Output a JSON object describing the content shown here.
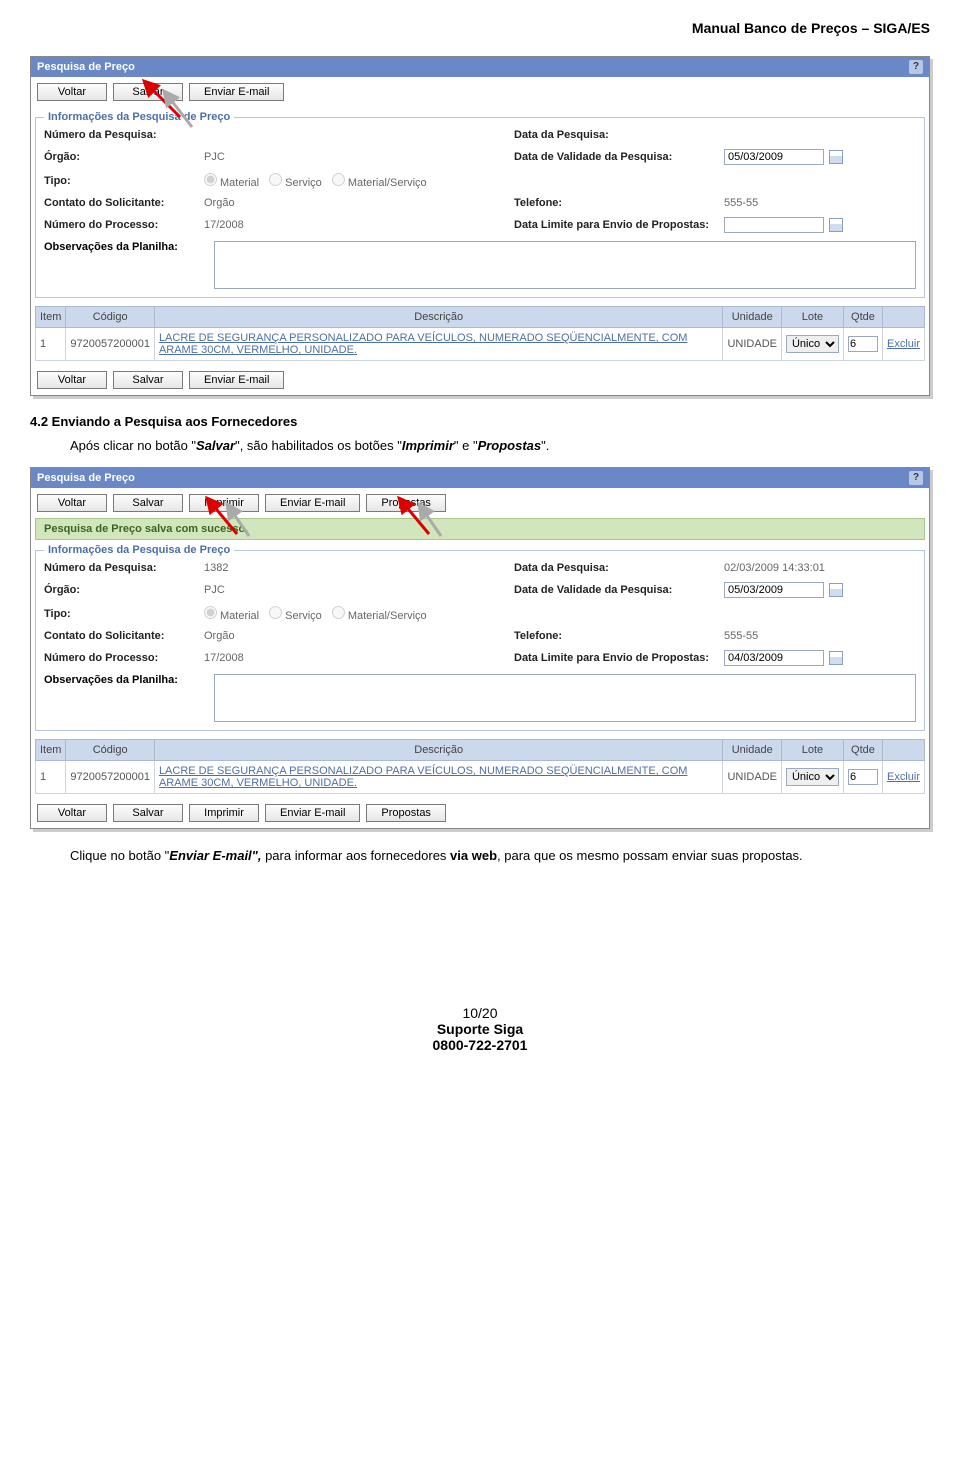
{
  "doc_header": "Manual Banco de Preços – SIGA/ES",
  "panel_title": "Pesquisa de Preço",
  "help_icon": "?",
  "buttons": {
    "voltar": "Voltar",
    "salvar": "Salvar",
    "imprimir": "Imprimir",
    "enviar_email": "Enviar E-mail",
    "propostas": "Propostas"
  },
  "success_msg": "Pesquisa de Preço salva com sucesso.",
  "fieldset_legend": "Informações da Pesquisa de Preço",
  "labels": {
    "numero_pesquisa": "Número da Pesquisa:",
    "data_pesquisa": "Data da Pesquisa:",
    "orgao": "Órgão:",
    "data_validade": "Data de Validade da Pesquisa:",
    "tipo": "Tipo:",
    "contato": "Contato do Solicitante:",
    "telefone": "Telefone:",
    "numero_processo": "Número do Processo:",
    "data_limite": "Data Limite para Envio de Propostas:",
    "observacoes": "Observações da Planilha:"
  },
  "radio_options": {
    "material": "Material",
    "servico": "Serviço",
    "material_servico": "Material/Serviço"
  },
  "table_headers": {
    "item": "Item",
    "codigo": "Código",
    "descricao": "Descrição",
    "unidade": "Unidade",
    "lote": "Lote",
    "qtde": "Qtde"
  },
  "lote_options": {
    "unico": "Único"
  },
  "excluir_label": "Excluir",
  "shot1": {
    "numero_pesquisa": "",
    "data_pesquisa": "",
    "orgao": "PJC",
    "data_validade": "05/03/2009",
    "contato": "Orgão",
    "telefone": "555-55",
    "numero_processo": "17/2008",
    "data_limite": "",
    "observacoes": "",
    "row": {
      "item": "1",
      "codigo": "9720057200001",
      "descricao": "LACRE DE SEGURANÇA PERSONALIZADO PARA VEÍCULOS, NUMERADO SEQÜENCIALMENTE, COM ARAME 30CM, VERMELHO, UNIDADE.",
      "unidade": "UNIDADE",
      "lote": "Único",
      "qtde": "6"
    }
  },
  "shot2": {
    "numero_pesquisa": "1382",
    "data_pesquisa": "02/03/2009 14:33:01",
    "orgao": "PJC",
    "data_validade": "05/03/2009",
    "contato": "Orgão",
    "telefone": "555-55",
    "numero_processo": "17/2008",
    "data_limite": "04/03/2009",
    "observacoes": "",
    "row": {
      "item": "1",
      "codigo": "9720057200001",
      "descricao": "LACRE DE SEGURANÇA PERSONALIZADO PARA VEÍCULOS, NUMERADO SEQÜENCIALMENTE, COM ARAME 30CM, VERMELHO, UNIDADE.",
      "unidade": "UNIDADE",
      "lote": "Único",
      "qtde": "6"
    }
  },
  "section_heading": "4.2    Enviando a Pesquisa aos Fornecedores",
  "paragraph1_parts": {
    "p1": "Após clicar no botão \"",
    "p2": "Salvar",
    "p3": "\", são habilitados os botões \"",
    "p4": "Imprimir",
    "p5": "\" e \"",
    "p6": "Propostas",
    "p7": "\"."
  },
  "paragraph2_parts": {
    "p1": "Clique no botão \"",
    "p2": "Enviar E-mail",
    "p3": "\", ",
    "p4": "para informar aos fornecedores ",
    "p5": "via web",
    "p6": ", para que os mesmo possam enviar suas propostas."
  },
  "footer": {
    "page": "10/20",
    "line2": "Suporte Siga",
    "line3": "0800-722-2701"
  }
}
